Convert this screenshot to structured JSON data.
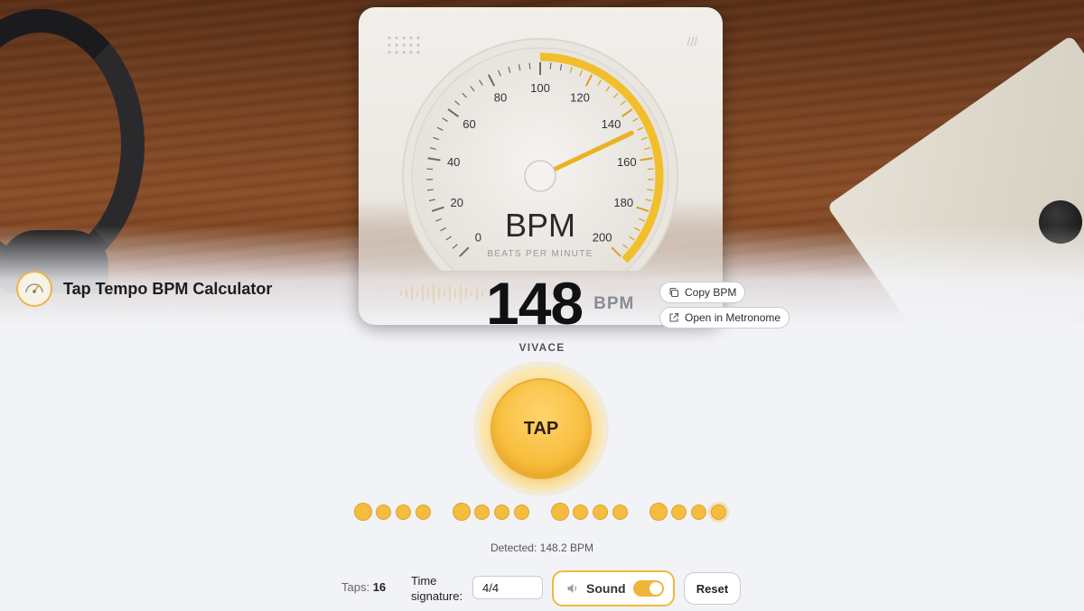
{
  "app": {
    "title": "Tap Tempo BPM Calculator"
  },
  "gauge": {
    "title": "BPM",
    "subtitle": "BEATS PER MINUTE",
    "ticks": [
      "0",
      "20",
      "40",
      "60",
      "80",
      "100",
      "120",
      "140",
      "160",
      "180",
      "200"
    ],
    "min": 0,
    "max": 200,
    "needle_value": 148,
    "accent_color": "#f2be2a"
  },
  "readout": {
    "bpm": "148",
    "unit": "BPM",
    "tempo_marking": "VIVACE",
    "copy_label": "Copy BPM",
    "metronome_label": "Open in Metronome"
  },
  "tap": {
    "label": "TAP"
  },
  "beats": {
    "groups": 4,
    "per_group": 4
  },
  "detected": "Detected: 148.2 BPM",
  "controls": {
    "taps_label": "Taps:",
    "taps_value": "16",
    "time_signature_label": "Time signature:",
    "time_signature_value": "4/4",
    "sound_label": "Sound",
    "sound_on": true,
    "reset_label": "Reset"
  },
  "icons": [
    "gauge-logo-icon",
    "copy-icon",
    "external-link-icon",
    "speaker-icon"
  ]
}
